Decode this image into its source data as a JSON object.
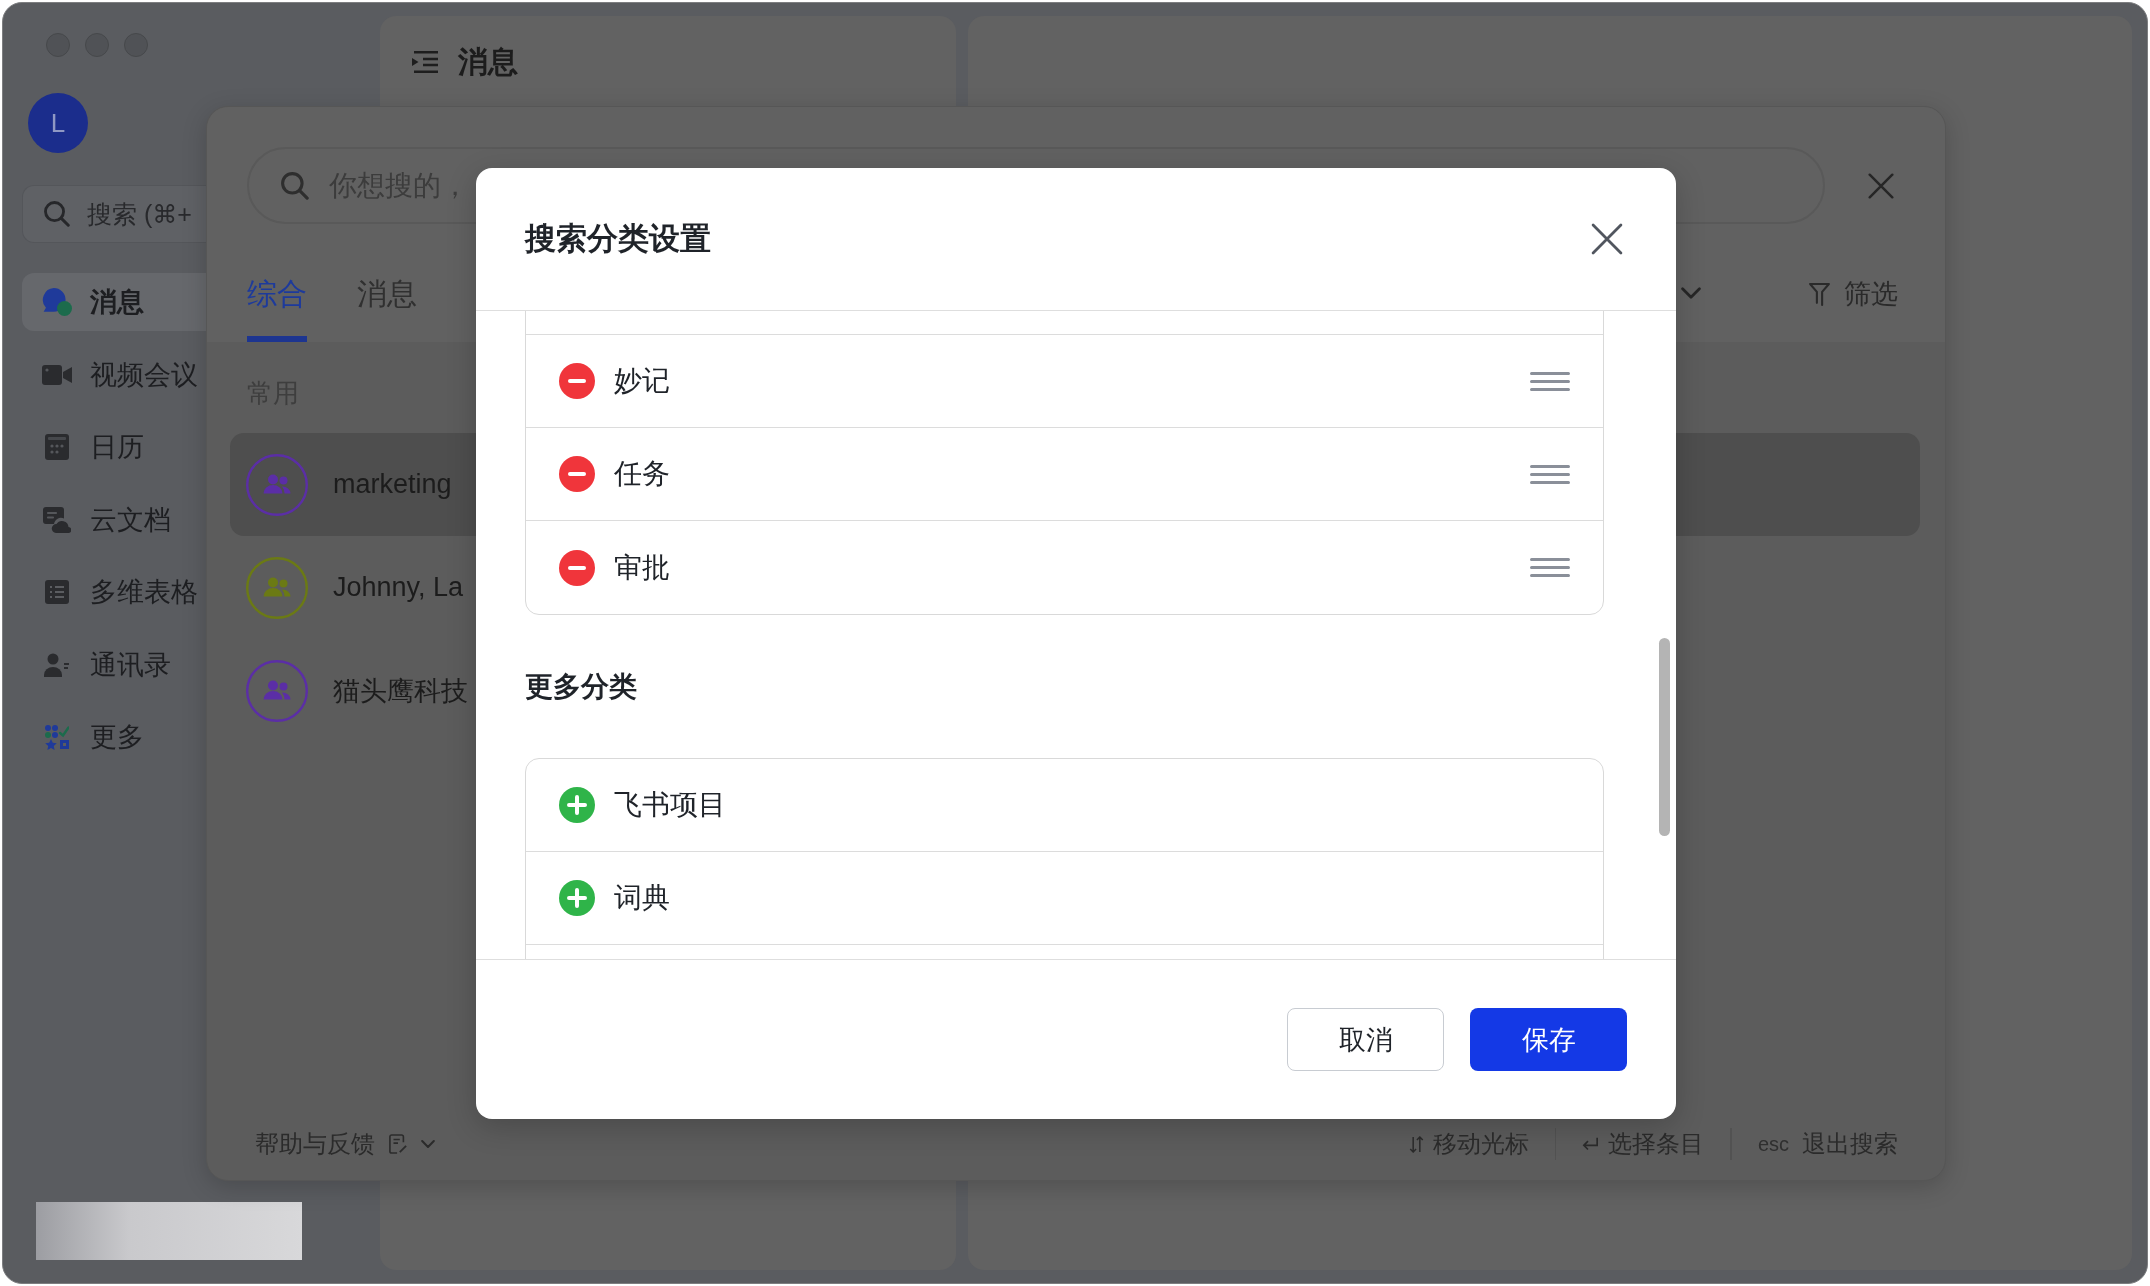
{
  "sidebar": {
    "avatar": "L",
    "search": {
      "placeholder": "搜索 (⌘+"
    },
    "items": [
      {
        "label": "消息",
        "selected": true
      },
      {
        "label": "视频会议",
        "selected": false
      },
      {
        "label": "日历",
        "selected": false
      },
      {
        "label": "云文档",
        "selected": false
      },
      {
        "label": "多维表格",
        "selected": false
      },
      {
        "label": "通讯录",
        "selected": false
      },
      {
        "label": "更多",
        "selected": false
      }
    ]
  },
  "chat_panel": {
    "title": "消息"
  },
  "search_panel": {
    "query": {
      "placeholder": "你想搜的，"
    },
    "tabs": [
      {
        "label": "综合",
        "selected": true
      },
      {
        "label": "消息",
        "selected": false
      }
    ],
    "filter": "筛选",
    "section": "常用",
    "results": [
      {
        "name": "marketing",
        "color": "#5b2ea6",
        "selected": true
      },
      {
        "name": "Johnny, La",
        "color": "#6b7a14",
        "selected": false
      },
      {
        "name": "猫头鹰科技",
        "color": "#5b2ea6",
        "selected": false
      }
    ],
    "footer": {
      "help": "帮助与反馈",
      "hints": [
        {
          "kind": "arrows",
          "label": "移动光标"
        },
        {
          "kind": "enter",
          "label": "选择条目"
        },
        {
          "kind": "key",
          "key": "esc",
          "label": "退出搜索"
        }
      ]
    }
  },
  "dialog": {
    "title": "搜索分类设置",
    "enabled": [
      {
        "label": "妙记"
      },
      {
        "label": "任务"
      },
      {
        "label": "审批"
      }
    ],
    "more_title": "更多分类",
    "more": [
      {
        "label": "飞书项目"
      },
      {
        "label": "词典"
      }
    ],
    "buttons": [
      {
        "label": "取消",
        "kind": "secondary"
      },
      {
        "label": "保存",
        "kind": "primary"
      }
    ]
  }
}
